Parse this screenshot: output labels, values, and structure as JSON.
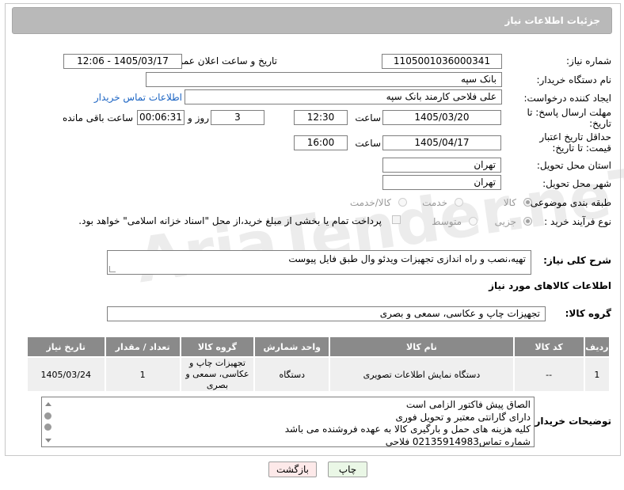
{
  "header": {
    "title": "جزئیات اطلاعات نیاز"
  },
  "form": {
    "need_number_label": "شماره نیاز:",
    "need_number": "1105001036000341",
    "announce_label": "تاریخ و ساعت اعلان عمومی:",
    "announce_value": "1405/03/17 - 12:06",
    "buyer_org_label": "نام دستگاه خریدار:",
    "buyer_org": "بانک سپه",
    "creator_label": "ایجاد کننده درخواست:",
    "creator": "علی فلاحی کارمند بانک سپه",
    "contact_link": "اطلاعات تماس خریدار",
    "deadline_label": "مهلت ارسال پاسخ: تا تاریخ:",
    "deadline_date": "1405/03/20",
    "time_label": "ساعت",
    "deadline_time": "12:30",
    "days": "3",
    "day_and_label": "روز و",
    "remaining_time": "00:06:31",
    "remaining_label": "ساعت باقی مانده",
    "validity_label": "حداقل تاریخ اعتبار قیمت: تا تاریخ:",
    "validity_date": "1405/04/17",
    "validity_time": "16:00",
    "province_label": "استان محل تحویل:",
    "province": "تهران",
    "city_label": "شهر محل تحویل:",
    "city": "تهران",
    "category_label": "طبقه بندی موضوعی:",
    "category_options": [
      "کالا",
      "خدمت",
      "کالا/خدمت"
    ],
    "process_label": "نوع فرآیند خرید :",
    "process_options": [
      "جزیی",
      "متوسط"
    ],
    "payment_note": "پرداخت تمام یا بخشی از مبلغ خرید،از محل \"اسناد خزانه اسلامی\" خواهد بود.",
    "description_label": "شرح کلی نیاز:",
    "description": "تهیه،نصب و راه اندازی تجهیزات ویدئو وال طبق فایل پیوست"
  },
  "goods": {
    "section_title": "اطلاعات کالاهای مورد نیاز",
    "group_label": "گروه کالا:",
    "group_value": "تجهیزات چاپ و عکاسی، سمعی و بصری",
    "columns": [
      "ردیف",
      "کد کالا",
      "نام کالا",
      "واحد شمارش",
      "گروه کالا",
      "تعداد / مقدار",
      "تاریخ نیاز"
    ],
    "rows": [
      [
        "1",
        "--",
        "دستگاه نمایش اطلاعات تصویری",
        "دستگاه",
        "تجهیزات چاپ و عکاسی، سمعی و بصری",
        "1",
        "1405/03/24"
      ]
    ]
  },
  "notes": {
    "label": "توضیحات خریدار:",
    "lines": [
      "الصاق پیش فاکتور الزامی است",
      "دارای گارانتی معتبر و تحویل فوری",
      "کلیه هزینه های حمل و  بارگیری کالا به عهده فروشنده می باشد",
      "شماره تماس02135914983 فلاحی"
    ]
  },
  "buttons": {
    "print": "چاپ",
    "back": "بازگشت"
  },
  "watermark": "AriaTender.neT",
  "colors": {
    "header_bg": "#b9b9b9",
    "table_header_bg": "#8a8a8a",
    "link": "#1b64c3",
    "back_btn_bg": "#fde9e9",
    "print_btn_bg": "#eaf7e6"
  }
}
